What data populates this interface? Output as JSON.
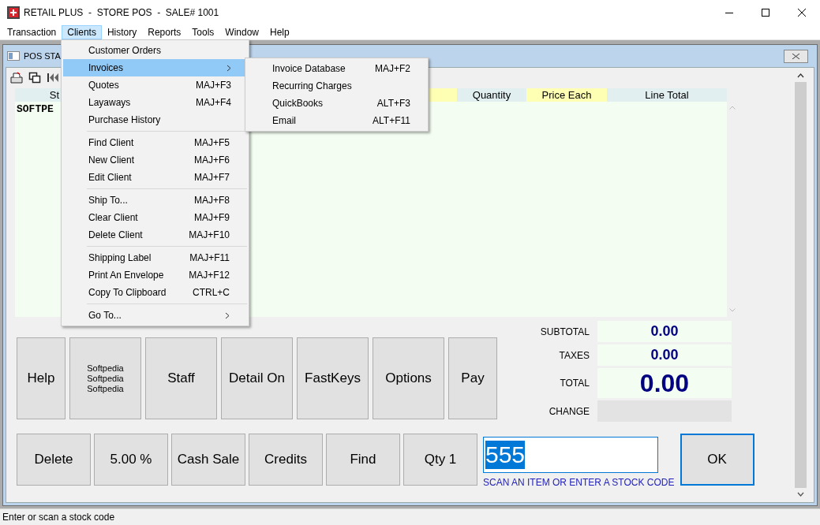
{
  "window": {
    "title": "RETAIL PLUS  -  STORE POS  -  SALE# 1001"
  },
  "menu_bar": [
    {
      "label": "Transaction",
      "selected": false
    },
    {
      "label": "Clients",
      "selected": true
    },
    {
      "label": "History",
      "selected": false
    },
    {
      "label": "Reports",
      "selected": false
    },
    {
      "label": "Tools",
      "selected": false
    },
    {
      "label": "Window",
      "selected": false
    },
    {
      "label": "Help",
      "selected": false
    }
  ],
  "clients_menu": {
    "groups": [
      [
        {
          "label": "Customer Orders",
          "selected": false,
          "submenu": false
        },
        {
          "label": "Invoices",
          "selected": true,
          "submenu": true
        },
        {
          "label": "Quotes",
          "shortcut": "MAJ+F3",
          "selected": false,
          "submenu": false
        },
        {
          "label": "Layaways",
          "shortcut": "MAJ+F4",
          "selected": false,
          "submenu": false
        },
        {
          "label": "Purchase History",
          "selected": false,
          "submenu": false
        }
      ],
      [
        {
          "label": "Find Client",
          "shortcut": "MAJ+F5",
          "selected": false,
          "submenu": false
        },
        {
          "label": "New Client",
          "shortcut": "MAJ+F6",
          "selected": false,
          "submenu": false
        },
        {
          "label": "Edit Client",
          "shortcut": "MAJ+F7",
          "selected": false,
          "submenu": false
        }
      ],
      [
        {
          "label": "Ship To...",
          "shortcut": "MAJ+F8",
          "selected": false,
          "submenu": false
        },
        {
          "label": "Clear Client",
          "shortcut": "MAJ+F9",
          "selected": false,
          "submenu": false
        },
        {
          "label": "Delete Client",
          "shortcut": "MAJ+F10",
          "selected": false,
          "submenu": false
        }
      ],
      [
        {
          "label": "Shipping Label",
          "shortcut": "MAJ+F11",
          "selected": false,
          "submenu": false
        },
        {
          "label": "Print An Envelope",
          "shortcut": "MAJ+F12",
          "selected": false,
          "submenu": false
        },
        {
          "label": "Copy To Clipboard",
          "shortcut": "CTRL+C",
          "selected": false,
          "submenu": false
        }
      ],
      [
        {
          "label": "Go To...",
          "selected": false,
          "submenu": true
        }
      ]
    ]
  },
  "invoices_submenu": [
    {
      "label": "Invoice Database",
      "shortcut": "MAJ+F2"
    },
    {
      "label": "Recurring Charges"
    },
    {
      "label": "QuickBooks",
      "shortcut": "ALT+F3"
    },
    {
      "label": "Email",
      "shortcut": "ALT+F11"
    }
  ],
  "document": {
    "title": "POS STA"
  },
  "grid": {
    "columns": [
      {
        "label": "St",
        "highlight": false
      },
      {
        "highlight": true
      },
      {
        "label": "Quantity",
        "highlight": false
      },
      {
        "label": "Price Each",
        "highlight": true
      },
      {
        "label": "Line Total",
        "highlight": false
      }
    ],
    "rows": [
      {
        "cells": [
          "SOFTPE"
        ]
      }
    ]
  },
  "function_buttons": [
    {
      "kind": "single",
      "label": "Help"
    },
    {
      "kind": "stack",
      "lines": [
        "Softpedia",
        "Softpedia",
        "Softpedia"
      ]
    },
    {
      "kind": "single",
      "label": "Staff"
    },
    {
      "kind": "single",
      "label": "Detail On"
    },
    {
      "kind": "single",
      "label": "FastKeys"
    },
    {
      "kind": "single",
      "label": "Options"
    },
    {
      "kind": "single",
      "label": "Pay"
    }
  ],
  "totals": [
    {
      "label": "SUBTOTAL",
      "value": "0.00",
      "kind": "normal"
    },
    {
      "label": "TAXES",
      "value": "0.00",
      "kind": "normal"
    },
    {
      "label": "TOTAL",
      "value": "0.00",
      "kind": "large"
    },
    {
      "label": "CHANGE",
      "kind": "empty"
    }
  ],
  "action_buttons": [
    "Delete",
    "5.00 %",
    "Cash Sale",
    "Credits",
    "Find",
    "Qty 1"
  ],
  "scan": {
    "value": "555",
    "text_selected": true,
    "hint": "SCAN AN ITEM OR ENTER A STOCK CODE"
  },
  "ok_button": "OK",
  "status_bar": "Enter or scan a stock code"
}
